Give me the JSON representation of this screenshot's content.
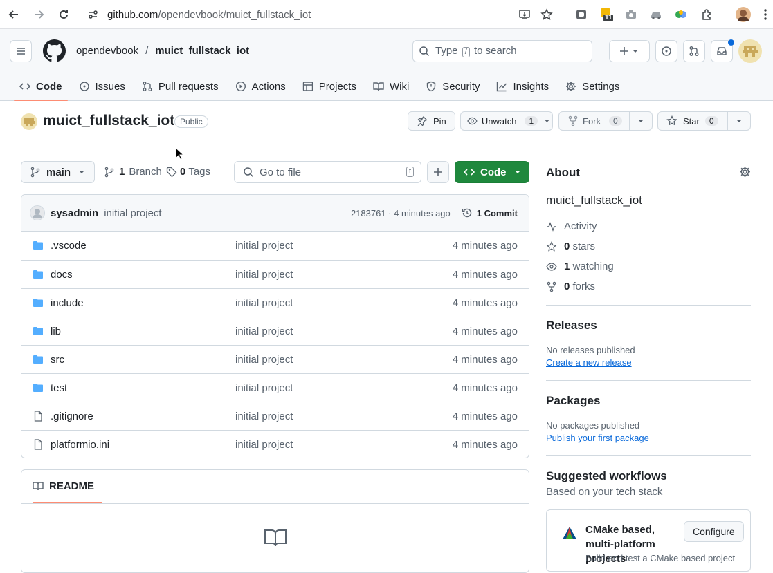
{
  "browser": {
    "url_host": "github.com",
    "url_path": "/opendevbook/muict_fullstack_iot",
    "ext_badge": "11"
  },
  "header": {
    "owner": "opendevbook",
    "separator": "/",
    "repo": "muict_fullstack_iot",
    "search_prefix": "Type",
    "search_key": "/",
    "search_suffix": "to search"
  },
  "tabs": [
    {
      "label": "Code",
      "icon": "code-icon"
    },
    {
      "label": "Issues",
      "icon": "issue-icon"
    },
    {
      "label": "Pull requests",
      "icon": "pull-request-icon"
    },
    {
      "label": "Actions",
      "icon": "play-icon"
    },
    {
      "label": "Projects",
      "icon": "table-icon"
    },
    {
      "label": "Wiki",
      "icon": "book-icon"
    },
    {
      "label": "Security",
      "icon": "shield-icon"
    },
    {
      "label": "Insights",
      "icon": "graph-icon"
    },
    {
      "label": "Settings",
      "icon": "gear-icon"
    }
  ],
  "repo": {
    "name": "muict_fullstack_iot",
    "visibility": "Public",
    "pin": "Pin",
    "unwatch": "Unwatch",
    "watch_count": "1",
    "fork": "Fork",
    "fork_count": "0",
    "star": "Star",
    "star_count": "0"
  },
  "toolbar": {
    "branch": "main",
    "branch_count": "1",
    "branch_label": "Branch",
    "tag_count": "0",
    "tag_label": "Tags",
    "goto_placeholder": "Go to file",
    "goto_key": "t",
    "code_label": "Code"
  },
  "commit": {
    "author": "sysadmin",
    "message": "initial project",
    "hash_time": "2183761 · 4 minutes ago",
    "commits": "1 Commit"
  },
  "files": [
    {
      "name": ".vscode",
      "type": "folder",
      "message": "initial project",
      "age": "4 minutes ago"
    },
    {
      "name": "docs",
      "type": "folder",
      "message": "initial project",
      "age": "4 minutes ago"
    },
    {
      "name": "include",
      "type": "folder",
      "message": "initial project",
      "age": "4 minutes ago"
    },
    {
      "name": "lib",
      "type": "folder",
      "message": "initial project",
      "age": "4 minutes ago"
    },
    {
      "name": "src",
      "type": "folder",
      "message": "initial project",
      "age": "4 minutes ago"
    },
    {
      "name": "test",
      "type": "folder",
      "message": "initial project",
      "age": "4 minutes ago"
    },
    {
      "name": ".gitignore",
      "type": "file",
      "message": "initial project",
      "age": "4 minutes ago"
    },
    {
      "name": "platformio.ini",
      "type": "file",
      "message": "initial project",
      "age": "4 minutes ago"
    }
  ],
  "readme": {
    "tab": "README"
  },
  "about": {
    "title": "About",
    "description": "muict_fullstack_iot",
    "activity": "Activity",
    "stars_n": "0",
    "stars_l": "stars",
    "watching_n": "1",
    "watching_l": "watching",
    "forks_n": "0",
    "forks_l": "forks"
  },
  "releases": {
    "title": "Releases",
    "none": "No releases published",
    "link": "Create a new release"
  },
  "packages": {
    "title": "Packages",
    "none": "No packages published",
    "link": "Publish your first package"
  },
  "workflows": {
    "title": "Suggested workflows",
    "subtitle": "Based on your tech stack",
    "card_title": "CMake based, multi-platform projects",
    "card_desc": "Build and test a CMake based project",
    "configure": "Configure"
  },
  "colors": {
    "accent_green": "#1f883d",
    "folder_blue": "#54aeff",
    "link_blue": "#0969da",
    "tab_underline": "#fd8c73"
  }
}
